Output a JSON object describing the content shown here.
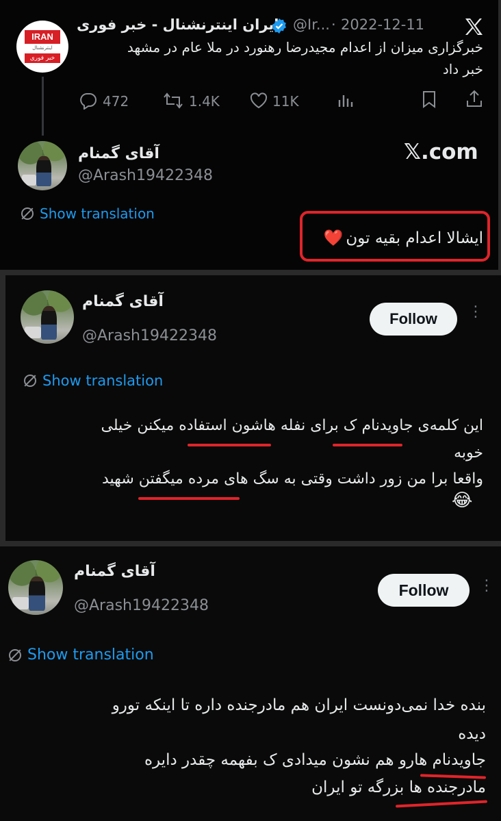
{
  "tweet1": {
    "logo_top": "IRAN",
    "logo_mid": "اینترنشنال",
    "logo_bottom": "خبر فوری",
    "author_name": "ایران اینترنشنال - خبر فوری",
    "handle": "@Ir...",
    "date": "2022-12-11",
    "text_line1": "خبرگزاری میزان از اعدام مجیدرضا رهنورد در ملا عام در مشهد",
    "text_line2": "خبر داد",
    "replies": "472",
    "reposts": "1.4K",
    "likes": "11K"
  },
  "reply1": {
    "author_name": "آقای گمنام",
    "handle": "@Arash19422348",
    "show_translation": "Show translation",
    "text": "ایشالا اعدام بقیه تون",
    "emoji": "❤️",
    "watermark": "𝕏.com"
  },
  "reply2": {
    "author_name": "آقای گمنام",
    "handle": "@Arash19422348",
    "follow_label": "Follow",
    "show_translation": "Show translation",
    "line1": "این کلمه‌ی جاویدنام ک برای نفله هاشون استفاده میکنن خیلی",
    "line2": "خوبه",
    "line3": "واقعا برا من زور داشت وقتی به سگ های مرده میگفتن شهید",
    "emoji": "😂"
  },
  "reply3": {
    "author_name": "آقای گمنام",
    "handle": "@Arash19422348",
    "follow_label": "Follow",
    "show_translation": "Show translation",
    "line1": "بنده خدا نمی‌دونست ایران هم مادرجنده داره تا اینکه تورو",
    "line2": "دیده",
    "line3": "جاویدنام هارو هم نشون میدادی ک بفهمه چقدر دایره",
    "line4": "مادرجنده ها بزرگه تو ایران"
  },
  "icons": [
    "x-logo-icon",
    "verified-badge-icon",
    "reply-icon",
    "repost-icon",
    "like-icon",
    "views-icon",
    "bookmark-icon",
    "share-icon",
    "translate-icon",
    "more-icon"
  ],
  "colors": {
    "link": "#1d9bf0",
    "highlight": "#e0242a",
    "verified": "#1d9bf0",
    "logo_red": "#d71f26"
  }
}
